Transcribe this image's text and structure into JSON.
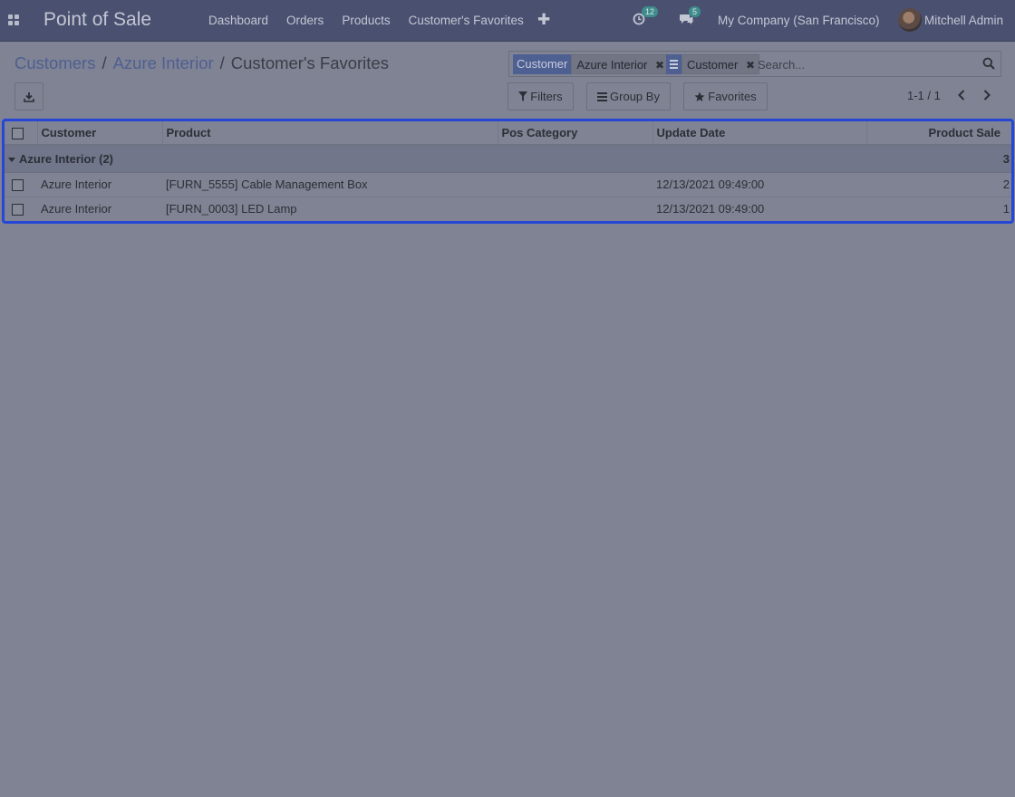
{
  "navbar": {
    "app_name": "Point of Sale",
    "menu": [
      "Dashboard",
      "Orders",
      "Products",
      "Customer's Favorites"
    ],
    "activity_count": "12",
    "message_count": "5",
    "company": "My Company (San Francisco)",
    "user": "Mitchell Admin"
  },
  "breadcrumb": {
    "items": [
      "Customers",
      "Azure Interior"
    ],
    "current": "Customer's Favorites"
  },
  "search": {
    "facets": [
      {
        "label": "Customer",
        "value": "Azure Interior"
      },
      {
        "label": "",
        "value": "Customer"
      }
    ],
    "placeholder": "Search..."
  },
  "controls": {
    "filters_label": "Filters",
    "groupby_label": "Group By",
    "favorites_label": "Favorites",
    "pager_value": "1-1 / 1"
  },
  "table": {
    "columns": [
      "Customer",
      "Product",
      "Pos Category",
      "Update Date",
      "Product Sale"
    ],
    "groups": [
      {
        "label": "Azure Interior (2)",
        "total": "3",
        "rows": [
          {
            "customer": "Azure Interior",
            "product": "[FURN_5555] Cable Management Box",
            "pos_category": "",
            "update_date": "12/13/2021 09:49:00",
            "product_sale": "2"
          },
          {
            "customer": "Azure Interior",
            "product": "[FURN_0003] LED Lamp",
            "pos_category": "",
            "update_date": "12/13/2021 09:49:00",
            "product_sale": "1"
          }
        ]
      }
    ]
  },
  "colors": {
    "navbar": "#4a5170",
    "background": "#7f8393",
    "link": "#4e5f91",
    "focus_border": "#2646d6",
    "badge": "#3f8c8c"
  }
}
